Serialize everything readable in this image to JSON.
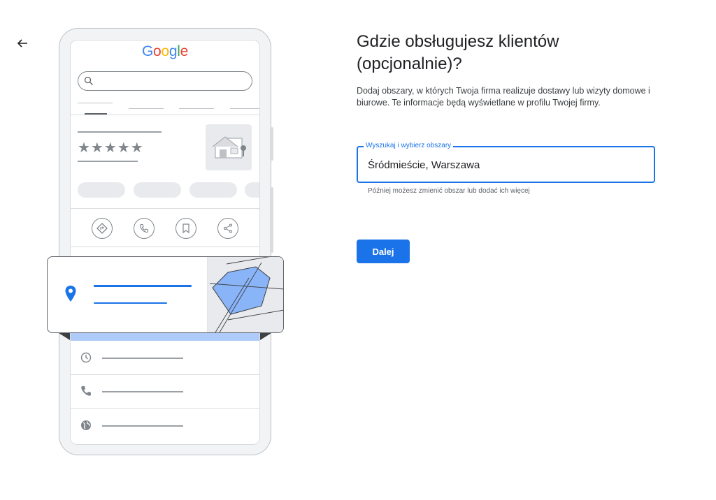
{
  "colors": {
    "accent": "#1a73e8",
    "text_primary": "#202124",
    "text_secondary": "#5f6368",
    "illustration_blue": "#8ab4f8"
  },
  "icons": {
    "back": "arrow-left-icon",
    "search": "search-icon",
    "directions": "directions-icon",
    "phone": "phone-icon",
    "bookmark": "bookmark-icon",
    "share": "share-icon",
    "location_pin": "location-pin-icon",
    "clock": "clock-icon",
    "globe": "globe-icon"
  },
  "illustration": {
    "logo_letters": [
      "G",
      "o",
      "o",
      "g",
      "l",
      "e"
    ],
    "logo_colors": [
      "#4285f4",
      "#ea4335",
      "#fbbc05",
      "#4285f4",
      "#34a853",
      "#ea4335"
    ],
    "rating_stars": "★★★★★"
  },
  "form": {
    "title": "Gdzie obsługujesz klientów (opcjonalnie)?",
    "description": "Dodaj obszary, w których Twoja firma realizuje dostawy lub wizyty domowe i biurowe. Te informacje będą wyświetlane w profilu Twojej firmy.",
    "field_label": "Wyszukaj i wybierz obszary",
    "field_value": "Śródmieście, Warszawa",
    "helper_text": "Później możesz zmienić obszar lub dodać ich więcej",
    "next_button": "Dalej"
  }
}
